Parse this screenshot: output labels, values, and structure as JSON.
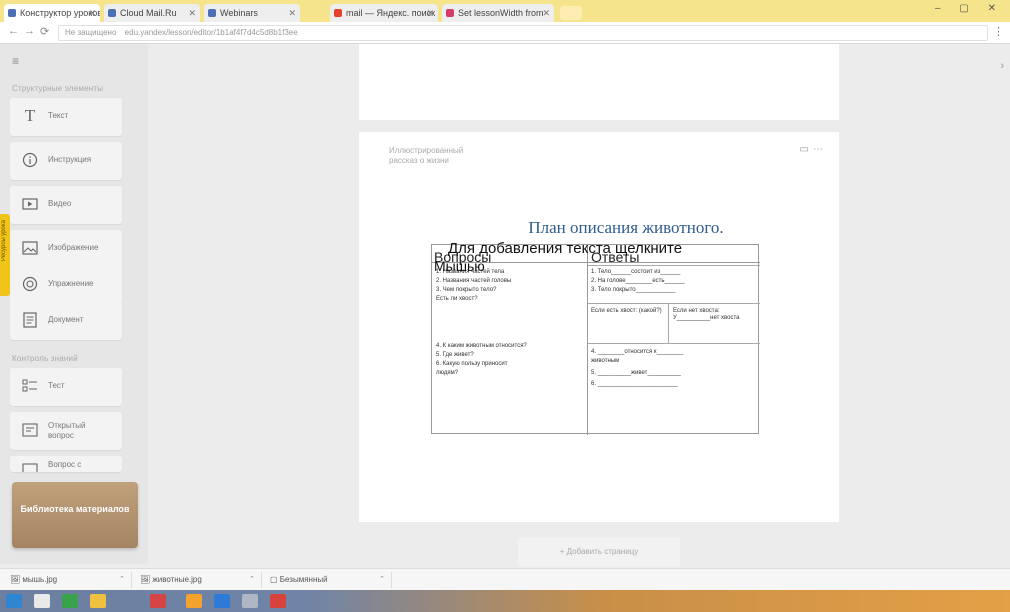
{
  "browser": {
    "tabs": [
      {
        "label": "Конструктор уроков"
      },
      {
        "label": "Cloud Mail.Ru"
      },
      {
        "label": "Webinars"
      },
      {
        "label": "mail — Яндекс. поиск"
      },
      {
        "label": "Set lessonWidth from"
      }
    ],
    "address": {
      "security_label": "Не защищено",
      "url": "edu.yandex/lesson/editor/1b1af4f7d4c5d8b1f3ee"
    }
  },
  "sidebar": {
    "section_blocks": "Структурные элементы",
    "items": [
      {
        "label": "Текст",
        "icon": "text-icon"
      },
      {
        "label": "Инструкция",
        "icon": "info-icon"
      },
      {
        "label": "Видео",
        "icon": "video-icon"
      },
      {
        "label": "Изображение",
        "icon": "image-icon"
      },
      {
        "label": "Упражнение",
        "icon": "exercise-icon"
      },
      {
        "label": "Документ",
        "icon": "document-icon"
      }
    ],
    "section_tasks": "Контроль знаний",
    "task_items": [
      {
        "label": "Тест",
        "icon": "test-icon"
      },
      {
        "label": "Открытый вопрос",
        "icon": "open-question-icon"
      },
      {
        "label": "Вопрос с",
        "icon": "question-icon"
      }
    ],
    "side_tab": "Ресурсы урока",
    "library_button": "Библиотека материалов"
  },
  "editor": {
    "block_hint": "Иллюстрированный рассказ о жизни",
    "image_title": "План описания животного.",
    "overlay_placeholder": "Для добавления текста щелкните",
    "overlay_subword": "Мышью",
    "table": {
      "col_questions": "Вопросы",
      "col_answers": "Ответы",
      "questions_block1": [
        "1.   Названия частей тела",
        "2.   Названия частей головы",
        "3.   Чем покрыто тело?",
        "       Есть ли хвост?"
      ],
      "questions_block2": [
        "4.   К каким животным относится?",
        "5.   Где живет?",
        "6.   Какую пользу приносит",
        "       людям?"
      ],
      "answers_block1": [
        "1.   Тело______состоит из______",
        "2.   На голове________есть______",
        "3.   Тело покрыто____________"
      ],
      "answer_tail_yes": "Если есть хвост: (какой?)",
      "answer_tail_no": "Если нет хвоста: У__________нет хвоста",
      "answers_block2": [
        "4.   ________относится к________",
        "       животным",
        "5.   __________живет__________",
        "6.   ________________________"
      ]
    },
    "add_page_button": "+  Добавить страницу"
  },
  "downloads": [
    {
      "label": "мышь.jpg"
    },
    {
      "label": "животные.jpg"
    },
    {
      "label": "Безымянный"
    }
  ],
  "colors": {
    "tabbar": "#f6e48c",
    "accent_library": "#a48462",
    "title_blue": "#2f5d8e",
    "side_tab": "#f0c419"
  }
}
